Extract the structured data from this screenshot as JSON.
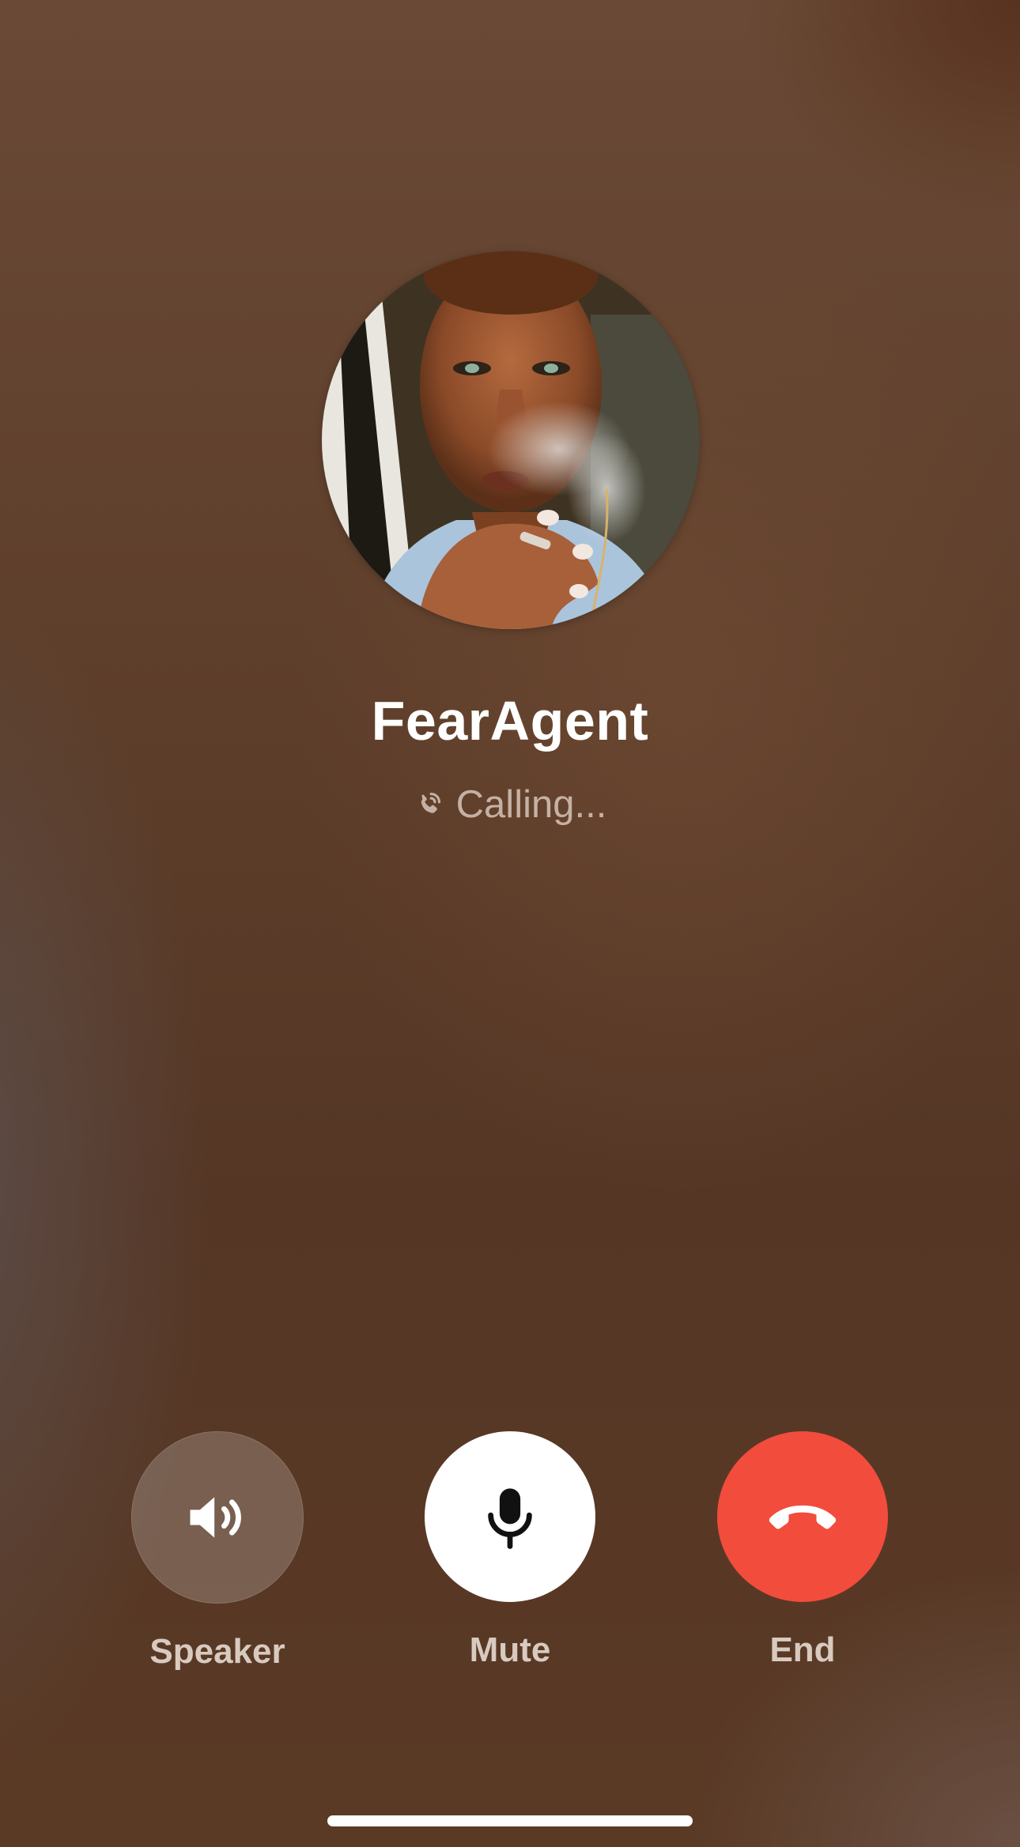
{
  "contact": {
    "name": "FearAgent",
    "status": "Calling..."
  },
  "controls": {
    "speaker_label": "Speaker",
    "mute_label": "Mute",
    "end_label": "End"
  },
  "icons": {
    "status": "phone-outgoing-icon",
    "speaker": "speaker-icon",
    "mute": "microphone-icon",
    "end": "phone-hangup-icon"
  },
  "colors": {
    "end_button": "#f24c3c",
    "mute_button": "#ffffff",
    "speaker_button": "rgba(255,255,255,0.2)"
  }
}
